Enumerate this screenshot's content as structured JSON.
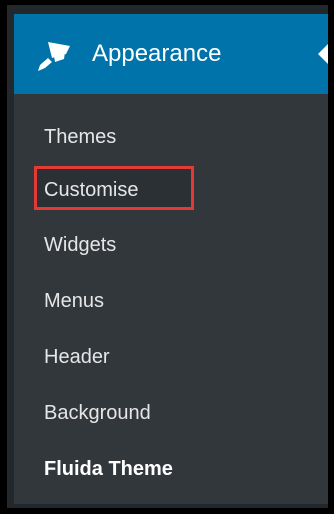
{
  "menu": {
    "title": "Appearance",
    "icon": "paintbrush-icon",
    "highlight_color": "#e53935",
    "accent_color": "#0073aa",
    "items": [
      {
        "label": "Themes"
      },
      {
        "label": "Customise",
        "highlighted": true
      },
      {
        "label": "Widgets"
      },
      {
        "label": "Menus"
      },
      {
        "label": "Header"
      },
      {
        "label": "Background"
      },
      {
        "label": "Fluida Theme",
        "current": true
      }
    ]
  }
}
